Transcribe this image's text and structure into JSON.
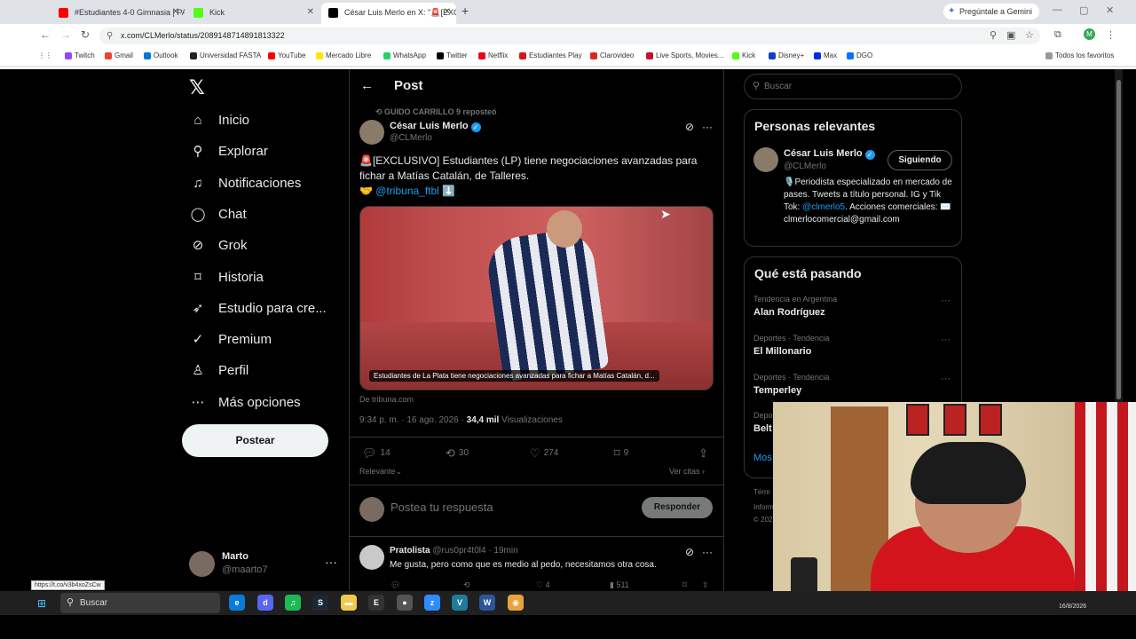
{
  "browser": {
    "tabs": [
      {
        "title": "#Estudiantes 4-0 Gimnasia | PA",
        "favicon_color": "#ff0000"
      },
      {
        "title": "Kick",
        "favicon_color": "#53fc18"
      },
      {
        "title": "César Luis Merlo en X: \"🚨[EXC",
        "favicon_color": "#000000"
      }
    ],
    "new_tab": "+",
    "gemini": "Pregúntale a Gemini",
    "url": "x.com/CLMerlo/status/2089148714891813322",
    "profile_initial": "M",
    "bookmarks": [
      {
        "label": "Twitch",
        "color": "#9146ff"
      },
      {
        "label": "Gmail",
        "color": "#ea4335"
      },
      {
        "label": "Outlook",
        "color": "#0078d4"
      },
      {
        "label": "Universidad FASTA",
        "color": "#222222"
      },
      {
        "label": "YouTube",
        "color": "#ff0000"
      },
      {
        "label": "Mercado Libre",
        "color": "#ffe600"
      },
      {
        "label": "WhatsApp",
        "color": "#25d366"
      },
      {
        "label": "Twitter",
        "color": "#000000"
      },
      {
        "label": "Netflix",
        "color": "#e50914"
      },
      {
        "label": "Estudiantes Play",
        "color": "#d4141c"
      },
      {
        "label": "Clarovideo",
        "color": "#da291c"
      },
      {
        "label": "Live Sports, Movies...",
        "color": "#c8102e"
      },
      {
        "label": "Kick",
        "color": "#53fc18"
      },
      {
        "label": "Disney+",
        "color": "#113ccf"
      },
      {
        "label": "Max",
        "color": "#002be7"
      },
      {
        "label": "DGO",
        "color": "#0a70ff"
      }
    ],
    "all_bookmarks": "Todos los favoritos",
    "status_url": "https://t.co/v3b4xoZsCw"
  },
  "sidebar": {
    "items": [
      {
        "label": "Inicio",
        "icon": "home-icon"
      },
      {
        "label": "Explorar",
        "icon": "search-icon"
      },
      {
        "label": "Notificaciones",
        "icon": "bell-icon"
      },
      {
        "label": "Chat",
        "icon": "chat-icon"
      },
      {
        "label": "Grok",
        "icon": "grok-icon"
      },
      {
        "label": "Historia",
        "icon": "bookmark-icon"
      },
      {
        "label": "Estudio para cre...",
        "icon": "rocket-icon"
      },
      {
        "label": "Premium",
        "icon": "premium-icon"
      },
      {
        "label": "Perfil",
        "icon": "person-icon"
      },
      {
        "label": "Más opciones",
        "icon": "more-icon"
      }
    ],
    "post_button": "Postear",
    "user": {
      "name": "Marto",
      "handle": "@maarto7"
    }
  },
  "post": {
    "header_title": "Post",
    "reposted_by": "GUIDO CARRILLO 9 reposteó",
    "author_name": "César Luis Merlo",
    "author_handle": "@CLMerlo",
    "text_line1": "🚨[EXCLUSIVO] Estudiantes (LP) tiene negociaciones avanzadas para fichar a Matías Catalán, de Talleres.",
    "text_emoji": "🤝",
    "text_link": "@tribuna_ftbl",
    "text_arrow": "⬇️",
    "media_caption": "Estudiantes de La Plata tiene negociaciones avanzadas para fichar a Matías Catalán, d...",
    "source": "De tribuna.com",
    "time": "9:34 p. m. · 16 ago. 2026 ·",
    "views": "34,4 mil",
    "views_label": "Visualizaciones",
    "replies": "14",
    "reposts": "30",
    "likes": "274",
    "bookmarks": "9",
    "relevant": "Relevante",
    "quotes": "Ver citas",
    "reply_placeholder": "Postea tu respuesta",
    "reply_button": "Responder"
  },
  "comment": {
    "name": "Pratolista",
    "meta": "@rus0pr4t0l4 · 19min",
    "text": "Me gusta, pero como que es medio al pedo, necesitamos otra cosa.",
    "likes": "4",
    "views": "511"
  },
  "right": {
    "search_placeholder": "Buscar",
    "relevant_title": "Personas relevantes",
    "rel_name": "César Luis Merlo",
    "rel_handle": "@CLMerlo",
    "follow_label": "Siguiendo",
    "bio_1": "🎙️Periodista especializado en mercado de pases. Tweets a título personal. IG y Tik Tok:",
    "bio_link": "@clmerlo5",
    "bio_2": ". Acciones comerciales: ✉️ clmerlocomercial@gmail.com",
    "trending_title": "Qué está pasando",
    "trends": [
      {
        "context": "Tendencia en Argentina",
        "name": "Alan Rodríguez"
      },
      {
        "context": "Deportes · Tendencia",
        "name": "El Millonario"
      },
      {
        "context": "Deportes · Tendencia",
        "name": "Temperley"
      },
      {
        "context": "Depo",
        "name": "Belt"
      }
    ],
    "show_more": "Mos",
    "footer": [
      "Térm",
      "Inform",
      "© 202"
    ]
  },
  "taskbar": {
    "search": "Buscar",
    "date": "16/8/2026"
  }
}
